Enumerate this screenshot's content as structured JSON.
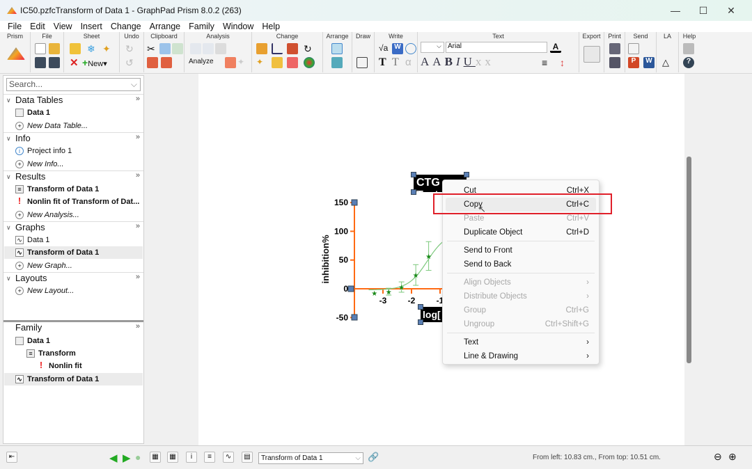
{
  "window": {
    "title": "IC50.pzfcTransform of Data 1 - GraphPad Prism 8.0.2 (263)"
  },
  "menu": [
    "File",
    "Edit",
    "View",
    "Insert",
    "Change",
    "Arrange",
    "Family",
    "Window",
    "Help"
  ],
  "ribbon": {
    "groups": [
      "Prism",
      "File",
      "Sheet",
      "Undo",
      "Clipboard",
      "Analysis",
      "Change",
      "Arrange",
      "Draw",
      "Write",
      "Text",
      "Export",
      "Print",
      "Send",
      "LA",
      "Help"
    ],
    "new_label": "New",
    "analyze_label": "Analyze",
    "font_size": "",
    "font_name": "Arial"
  },
  "sidebar": {
    "search_placeholder": "Search...",
    "sections": [
      {
        "title": "Data Tables",
        "items": [
          "Data 1",
          "New Data Table..."
        ]
      },
      {
        "title": "Info",
        "items": [
          "Project info 1",
          "New Info..."
        ]
      },
      {
        "title": "Results",
        "items": [
          "Transform of Data 1",
          "Nonlin fit of Transform of Dat...",
          "New Analysis..."
        ]
      },
      {
        "title": "Graphs",
        "items": [
          "Data 1",
          "Transform of Data 1",
          "New Graph..."
        ]
      },
      {
        "title": "Layouts",
        "items": [
          "New Layout..."
        ]
      }
    ],
    "family": {
      "title": "Family",
      "items": [
        "Data 1",
        "Transform",
        "Nonlin fit",
        "Transform of Data 1"
      ]
    }
  },
  "graph": {
    "title_text": "CTG Test",
    "xlabel_text": "log[",
    "ylabel": "inhibition%",
    "yticks": [
      "150",
      "100",
      "50",
      "0",
      "-50"
    ],
    "xticks": [
      "-3",
      "-2",
      "-1"
    ],
    "axis_color": "#ff6a13",
    "point_color": "#1a8a1a",
    "curve_color": "#7cc87c",
    "points": [
      {
        "x": -3.3,
        "y": -7,
        "err": 0
      },
      {
        "x": -2.8,
        "y": -5,
        "err": 6
      },
      {
        "x": -2.35,
        "y": 3,
        "err": 9
      },
      {
        "x": -1.85,
        "y": 24,
        "err": 18
      },
      {
        "x": -1.4,
        "y": 57,
        "err": 25
      }
    ]
  },
  "context_menu": [
    {
      "label": "Cut",
      "shortcut": "Ctrl+X",
      "enabled": true
    },
    {
      "label": "Copy",
      "shortcut": "Ctrl+C",
      "enabled": true,
      "highlighted": true
    },
    {
      "label": "Paste",
      "shortcut": "Ctrl+V",
      "enabled": false
    },
    {
      "label": "Duplicate Object",
      "shortcut": "Ctrl+D",
      "enabled": true
    },
    {
      "label": "Send to Front",
      "shortcut": "",
      "enabled": true
    },
    {
      "label": "Send to Back",
      "shortcut": "",
      "enabled": true
    },
    {
      "label": "Align Objects",
      "shortcut": "›",
      "enabled": false
    },
    {
      "label": "Distribute Objects",
      "shortcut": "›",
      "enabled": false
    },
    {
      "label": "Group",
      "shortcut": "Ctrl+G",
      "enabled": false
    },
    {
      "label": "Ungroup",
      "shortcut": "Ctrl+Shift+G",
      "enabled": false
    },
    {
      "label": "Text",
      "shortcut": "›",
      "enabled": true
    },
    {
      "label": "Line & Drawing",
      "shortcut": "›",
      "enabled": true
    }
  ],
  "statusbar": {
    "sheet_select": "Transform of Data 1",
    "position": "From left: 10.83 cm., From top: 10.51 cm."
  }
}
